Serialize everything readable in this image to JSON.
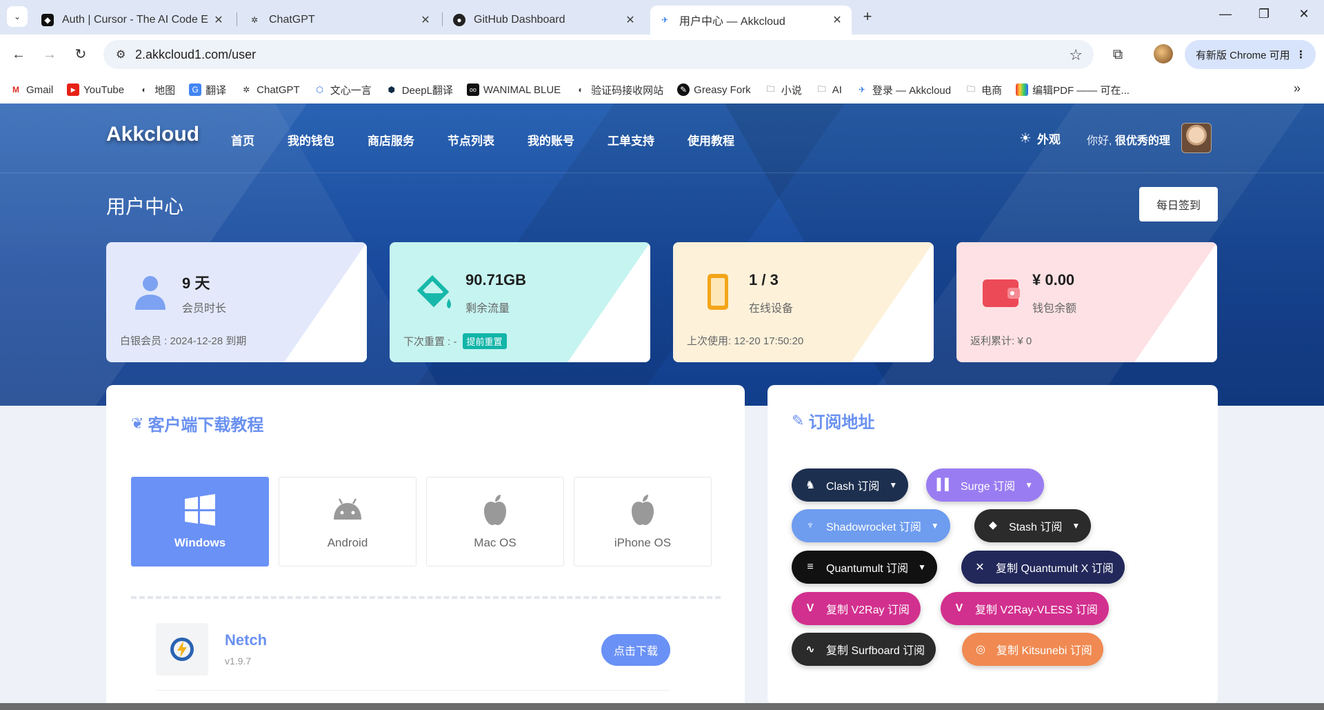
{
  "browser": {
    "tabs": [
      {
        "title": "Auth | Cursor - The AI Code E",
        "active": false
      },
      {
        "title": "ChatGPT",
        "active": false
      },
      {
        "title": "GitHub Dashboard",
        "active": false
      },
      {
        "title": "用户中心 — Akkcloud",
        "active": true
      }
    ],
    "url": "2.akkcloud1.com/user",
    "update_label": "有新版 Chrome 可用",
    "bookmarks": [
      "Gmail",
      "YouTube",
      "地图",
      "翻译",
      "ChatGPT",
      "文心一言",
      "DeepL翻译",
      "WANIMAL BLUE",
      "验证码接收网站",
      "Greasy Fork",
      "小说",
      "AI",
      "登录 — Akkcloud",
      "电商",
      "编辑PDF —— 可在..."
    ]
  },
  "site": {
    "brand": "Akkcloud",
    "nav": [
      "首页",
      "我的钱包",
      "商店服务",
      "节点列表",
      "我的账号",
      "工单支持",
      "使用教程"
    ],
    "appearance": "外观",
    "greeting_prefix": "你好,",
    "username": "很优秀的理",
    "page_title": "用户中心",
    "checkin": "每日签到"
  },
  "stats": [
    {
      "value": "9 天",
      "label": "会员时长",
      "footer": "白银会员 : 2024-12-28 到期",
      "bg": "#e3e9fb",
      "accent": "#7da2f2",
      "icon": "user-icon"
    },
    {
      "value": "90.71GB",
      "label": "剩余流量",
      "footer": "下次重置 :  -",
      "badge": "提前重置",
      "bg": "#c6f4f0",
      "accent": "#17b8aa",
      "icon": "bucket-icon"
    },
    {
      "value": "1 / 3",
      "label": "在线设备",
      "footer": "上次使用: 12-20 17:50:20",
      "bg": "#fdf1da",
      "accent": "#f3a51a",
      "icon": "phone-icon"
    },
    {
      "value": "¥ 0.00",
      "label": "钱包余额",
      "footer": "返利累计: ¥ 0",
      "bg": "#fde1e4",
      "accent": "#ec4a57",
      "icon": "wallet-icon"
    }
  ],
  "download": {
    "title": "客户端下载教程",
    "os_tabs": [
      "Windows",
      "Android",
      "Mac OS",
      "iPhone OS"
    ],
    "active_os": "Windows",
    "app": {
      "name": "Netch",
      "version": "v1.9.7",
      "button": "点击下载"
    }
  },
  "subscribe": {
    "title": "订阅地址",
    "buttons": [
      {
        "label": "Clash 订阅",
        "color": "#1d2f4f",
        "dropdown": true,
        "icon": "clash-icon"
      },
      {
        "label": "Surge 订阅",
        "color": "#9a7cf2",
        "dropdown": true,
        "icon": "surge-icon"
      },
      {
        "label": "Shadowrocket 订阅",
        "color": "#6e9cef",
        "dropdown": true,
        "icon": "shadowrocket-icon"
      },
      {
        "label": "Stash 订阅",
        "color": "#2b2b2b",
        "dropdown": true,
        "icon": "stash-icon"
      },
      {
        "label": "Quantumult 订阅",
        "color": "#111111",
        "dropdown": true,
        "icon": "quantumult-icon"
      },
      {
        "label": "复制 Quantumult X 订阅",
        "color": "#22285a",
        "dropdown": false,
        "icon": "quantumultx-icon"
      },
      {
        "label": "复制 V2Ray 订阅",
        "color": "#d2308e",
        "dropdown": false,
        "icon": "v2ray-icon"
      },
      {
        "label": "复制 V2Ray-VLESS 订阅",
        "color": "#d2308e",
        "dropdown": false,
        "icon": "v2ray-vless-icon"
      },
      {
        "label": "复制 Surfboard 订阅",
        "color": "#2b2b2b",
        "dropdown": false,
        "icon": "surfboard-icon"
      },
      {
        "label": "复制 Kitsunebi 订阅",
        "color": "#f08a52",
        "dropdown": false,
        "icon": "kitsunebi-icon"
      }
    ]
  }
}
